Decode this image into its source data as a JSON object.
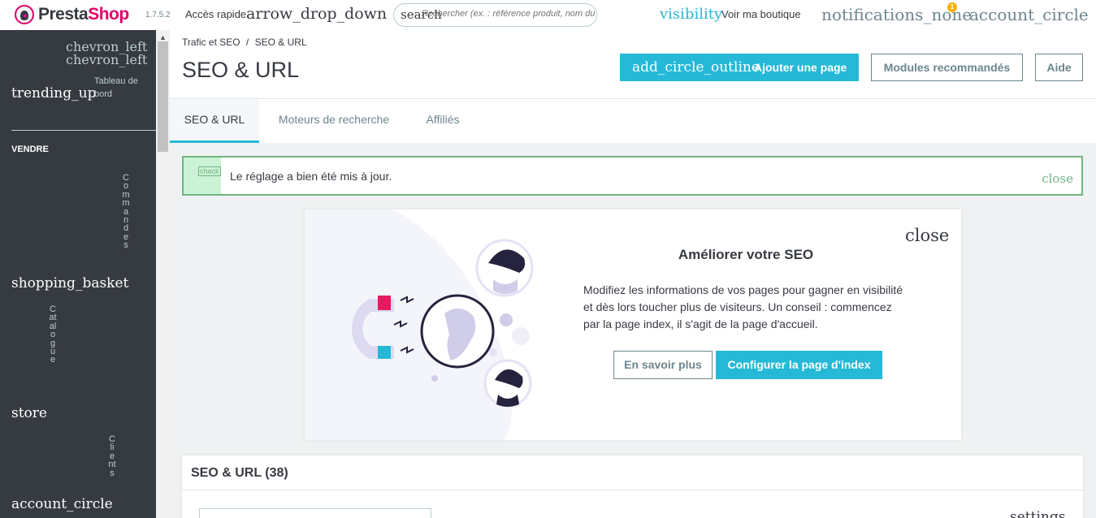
{
  "header": {
    "logo_presta": "Presta",
    "logo_shop": "Shop",
    "version": "1.7.5.2",
    "quick_access": "Accès rapide",
    "quick_access_icon": "arrow_drop_down",
    "search_icon": "search",
    "search_placeholder": "Rechercher (ex. : référence produit, nom du client…)",
    "visibility_icon": "visibility",
    "view_shop": "Voir ma boutique",
    "notifications_icon": "notifications_none",
    "notifications_count": "1",
    "account_icon": "account_circle"
  },
  "sidebar": {
    "collapse_icon_1": "chevron_left",
    "collapse_icon_2": "chevron_left",
    "dashboard_icon": "trending_up",
    "dashboard_label": "Tableau de bord",
    "section_sell": "VENDRE",
    "items": [
      {
        "icon": "shopping_basket",
        "label": "Commandes"
      },
      {
        "icon": "store",
        "label": "Catalogue"
      },
      {
        "icon": "account_circle",
        "label": "Clients"
      }
    ]
  },
  "toolbar": {
    "breadcrumb_parent": "Trafic et SEO",
    "breadcrumb_sep": "/",
    "breadcrumb_current": "SEO & URL",
    "title": "SEO & URL",
    "add_icon": "add_circle_outline",
    "add_label": "Ajouter une page",
    "modules_label": "Modules recommandés",
    "help_label": "Aide"
  },
  "tabs": [
    {
      "label": "SEO & URL",
      "active": true
    },
    {
      "label": "Moteurs de recherche",
      "active": false
    },
    {
      "label": "Affiliés",
      "active": false
    }
  ],
  "alert": {
    "icon": "check",
    "message": "Le réglage a bien été mis à jour.",
    "close_icon": "close"
  },
  "seo_card": {
    "close_icon": "close",
    "title": "Améliorer votre SEO",
    "text": "Modifiez les informations de vos pages pour gagner en visibilité et dès lors toucher plus de visiteurs. Un conseil : commencez par la page index, il s'agit de la page d'accueil.",
    "learn_more": "En savoir plus",
    "configure": "Configurer la page d'index"
  },
  "list": {
    "title": "SEO & URL (38)",
    "settings_icon": "settings"
  },
  "colors": {
    "primary": "#25b9d7",
    "sidebar": "#363a41",
    "success": "#70b580",
    "brand": "#df0067"
  }
}
